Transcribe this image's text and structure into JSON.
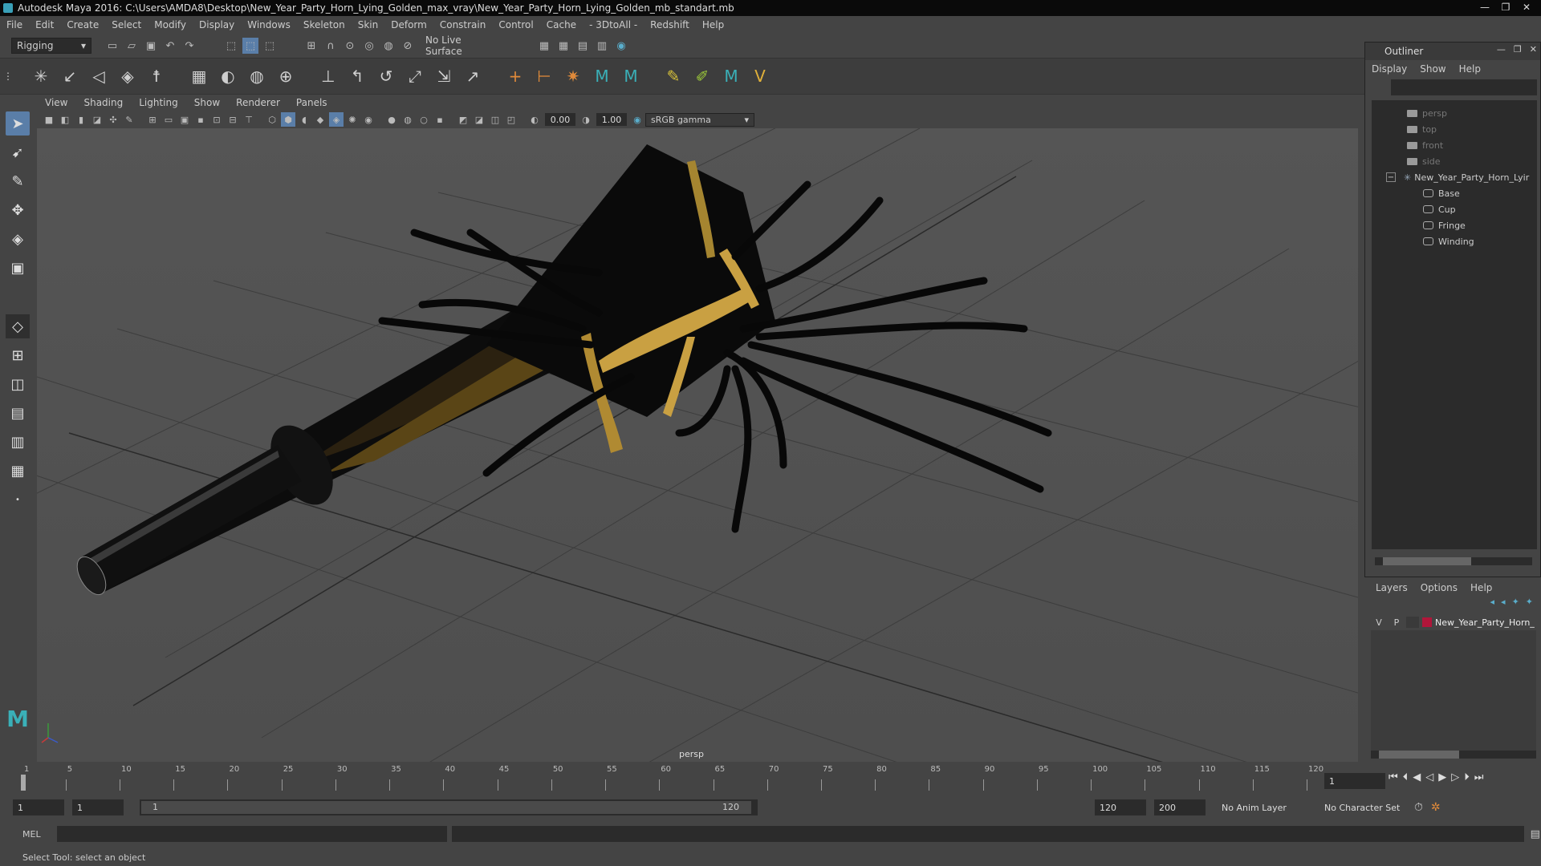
{
  "window": {
    "title": "Autodesk Maya 2016: C:\\Users\\AMDA8\\Desktop\\New_Year_Party_Horn_Lying_Golden_max_vray\\New_Year_Party_Horn_Lying_Golden_mb_standart.mb",
    "minimize": "—",
    "maximize": "❐",
    "close": "✕"
  },
  "menubar": [
    "File",
    "Edit",
    "Create",
    "Select",
    "Modify",
    "Display",
    "Windows",
    "Skeleton",
    "Skin",
    "Deform",
    "Constrain",
    "Control",
    "Cache",
    "- 3DtoAll -",
    "Redshift",
    "Help"
  ],
  "toolbar": {
    "mode": "Rigging",
    "live_surface": "No Live Surface"
  },
  "panel": {
    "menus": [
      "View",
      "Shading",
      "Lighting",
      "Show",
      "Renderer",
      "Panels"
    ],
    "exposure": "0.00",
    "gamma": "1.00",
    "color_space": "sRGB gamma",
    "camera_label": "persp"
  },
  "outliner": {
    "title": "Outliner",
    "menus": [
      "Display",
      "Show",
      "Help"
    ],
    "items": [
      {
        "label": "persp",
        "kind": "camera"
      },
      {
        "label": "top",
        "kind": "camera"
      },
      {
        "label": "front",
        "kind": "camera"
      },
      {
        "label": "side",
        "kind": "camera"
      },
      {
        "label": "New_Year_Party_Horn_Lyir",
        "kind": "group"
      },
      {
        "label": "Base",
        "kind": "mesh"
      },
      {
        "label": "Cup",
        "kind": "mesh"
      },
      {
        "label": "Fringe",
        "kind": "mesh"
      },
      {
        "label": "Winding",
        "kind": "mesh"
      }
    ]
  },
  "layers": {
    "menus": [
      "Layers",
      "Options",
      "Help"
    ],
    "layer": {
      "v": "V",
      "p": "P",
      "name": "New_Year_Party_Horn_",
      "color": "#b0163a"
    }
  },
  "timeline": {
    "ticks": [
      "1",
      "5",
      "10",
      "15",
      "20",
      "25",
      "30",
      "35",
      "40",
      "45",
      "50",
      "55",
      "60",
      "65",
      "70",
      "75",
      "80",
      "85",
      "90",
      "95",
      "100",
      "105",
      "110",
      "115",
      "120"
    ],
    "current_frame": "1"
  },
  "range": {
    "start": "1",
    "start2": "1",
    "slider_start": "1",
    "slider_end": "120",
    "end": "120",
    "end2": "200",
    "anim_layer": "No Anim Layer",
    "character_set": "No Character Set"
  },
  "command": {
    "label": "MEL"
  },
  "status": {
    "text": "Select Tool: select an object"
  },
  "colors": {
    "gold": "#c9a042",
    "bg": "#444444",
    "accent": "#5a7ea8"
  }
}
